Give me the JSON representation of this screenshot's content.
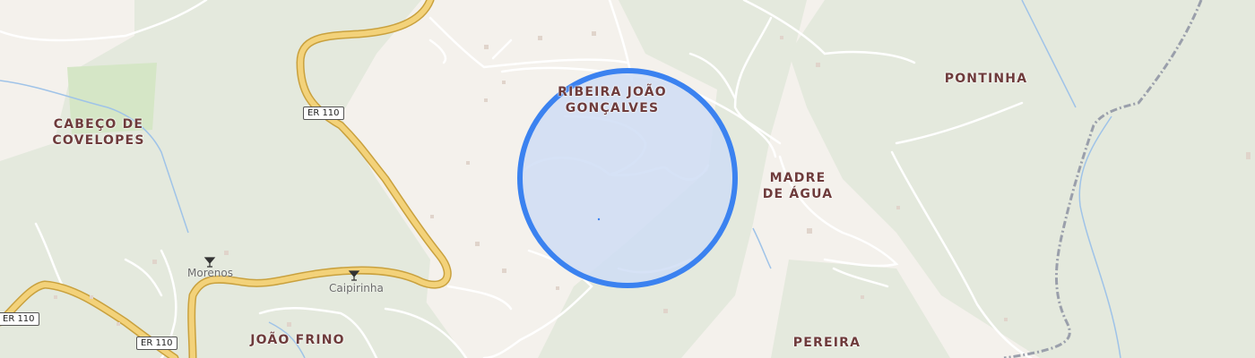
{
  "map": {
    "places": [
      {
        "id": "ribeira",
        "line1": "RIBEIRA JOÃO",
        "line2": "GONÇALVES"
      },
      {
        "id": "pontinha",
        "line1": "PONTINHA",
        "line2": ""
      },
      {
        "id": "cabeco",
        "line1": "CABEÇO DE",
        "line2": "COVELOPES"
      },
      {
        "id": "madre",
        "line1": "MADRE",
        "line2": "DE ÁGUA"
      },
      {
        "id": "joaofrino",
        "line1": "JOÃO FRINO",
        "line2": ""
      },
      {
        "id": "pereira",
        "line1": "PEREIRA",
        "line2": ""
      }
    ],
    "pois": [
      {
        "id": "morenos",
        "label": "Morenos",
        "icon": "cocktail-bar-icon"
      },
      {
        "id": "caipirinha",
        "label": "Caipirinha",
        "icon": "cocktail-bar-icon"
      }
    ],
    "road_shields": [
      "ER 110",
      "ER 110",
      "ER 110"
    ],
    "accuracy_circle": {
      "fill": "#cfddf5",
      "stroke": "#3b82f0"
    },
    "colors": {
      "land": "#f4f1ec",
      "forest": "#e3e8dc",
      "park": "#d7e9c8",
      "major_road": "#f1cf6e",
      "minor_road": "#ffffff",
      "water": "#9fc3e8",
      "boundary": "#9a9fab"
    }
  }
}
